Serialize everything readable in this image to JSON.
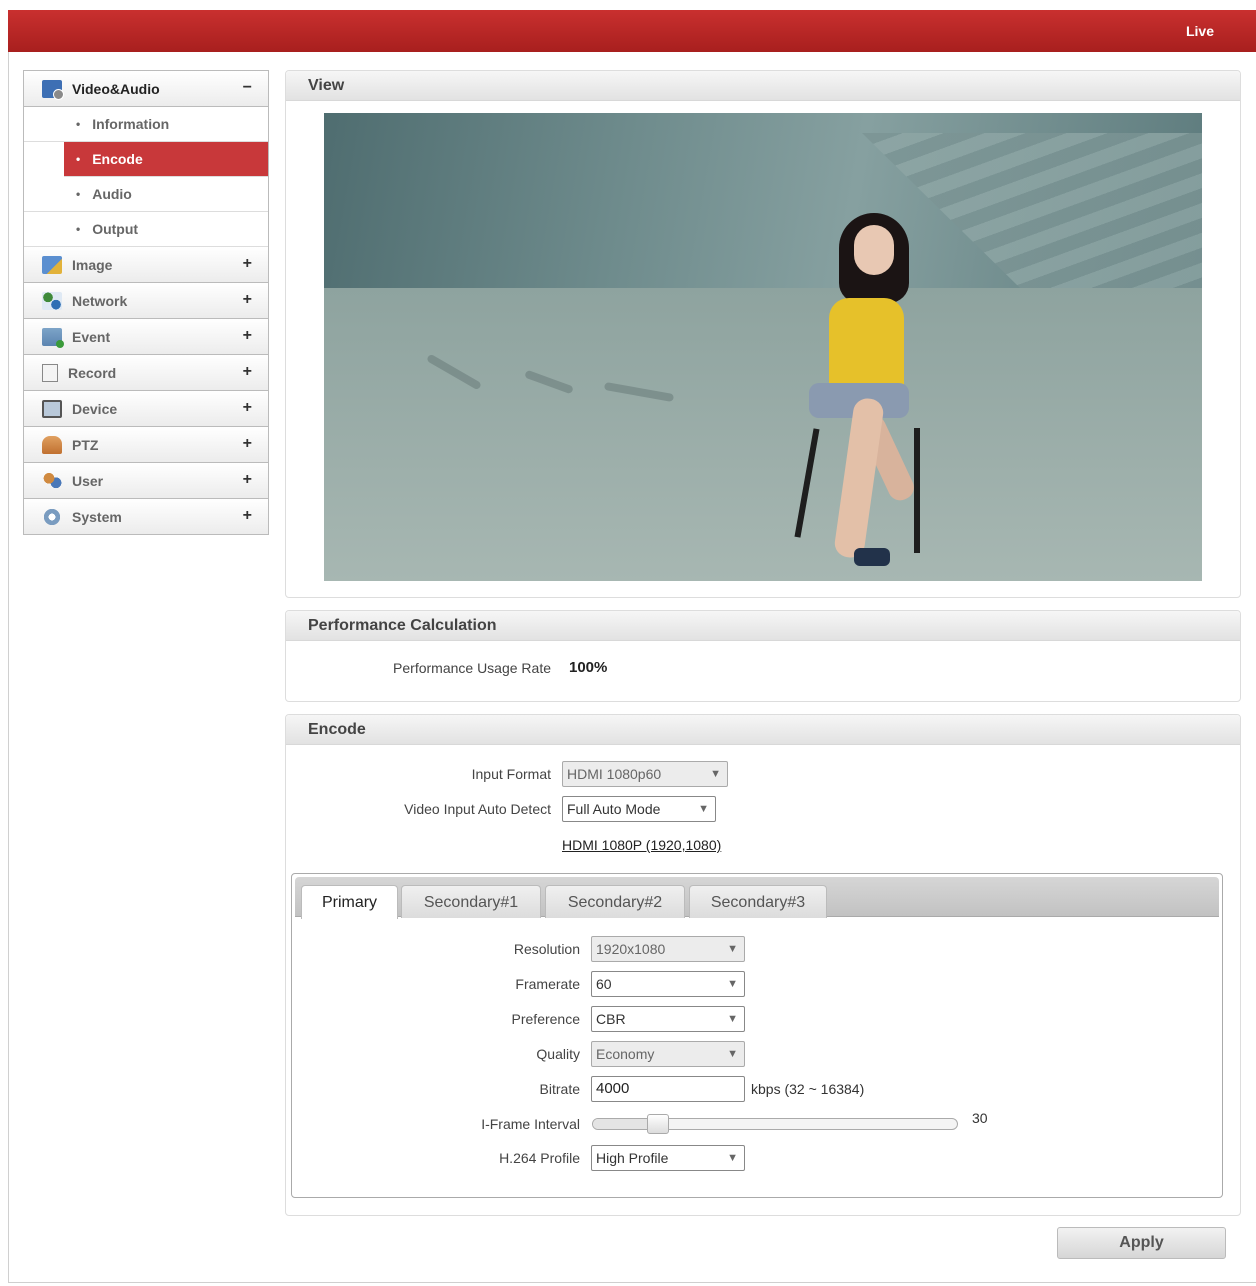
{
  "topbar": {
    "live_label": "Live"
  },
  "sidebar": {
    "video_audio": {
      "label": "Video&Audio",
      "toggle": "−",
      "items": [
        {
          "label": "Information"
        },
        {
          "label": "Encode"
        },
        {
          "label": "Audio"
        },
        {
          "label": "Output"
        }
      ]
    },
    "groups": [
      {
        "label": "Image",
        "toggle": "+"
      },
      {
        "label": "Network",
        "toggle": "+"
      },
      {
        "label": "Event",
        "toggle": "+"
      },
      {
        "label": "Record",
        "toggle": "+"
      },
      {
        "label": "Device",
        "toggle": "+"
      },
      {
        "label": "PTZ",
        "toggle": "+"
      },
      {
        "label": "User",
        "toggle": "+"
      },
      {
        "label": "System",
        "toggle": "+"
      }
    ],
    "bullet": "•"
  },
  "view_panel": {
    "title": "View"
  },
  "performance_panel": {
    "title": "Performance Calculation",
    "usage_label": "Performance Usage Rate",
    "usage_value": "100%"
  },
  "encode_panel": {
    "title": "Encode",
    "input_format_label": "Input Format",
    "input_format_value": "HDMI 1080p60",
    "auto_detect_label": "Video Input Auto Detect",
    "auto_detect_value": "Full Auto Mode",
    "detected_link": "HDMI 1080P (1920,1080)",
    "tabs": [
      {
        "label": "Primary"
      },
      {
        "label": "Secondary#1"
      },
      {
        "label": "Secondary#2"
      },
      {
        "label": "Secondary#3"
      }
    ],
    "resolution_label": "Resolution",
    "resolution_value": "1920x1080",
    "framerate_label": "Framerate",
    "framerate_value": "60",
    "preference_label": "Preference",
    "preference_value": "CBR",
    "quality_label": "Quality",
    "quality_value": "Economy",
    "bitrate_label": "Bitrate",
    "bitrate_value": "4000",
    "bitrate_unit": "kbps (32 ~ 16384)",
    "iframe_label": "I-Frame Interval",
    "iframe_value": "30",
    "iframe_fraction": 0.1,
    "profile_label": "H.264 Profile",
    "profile_value": "High Profile",
    "dropdown_arrow": "▼"
  },
  "apply_label": "Apply"
}
